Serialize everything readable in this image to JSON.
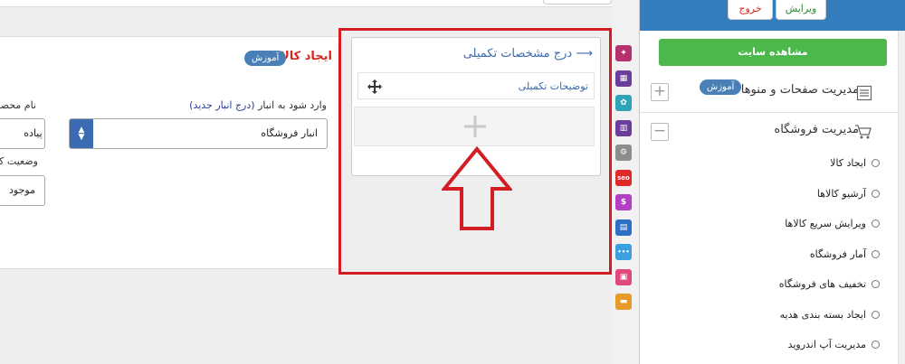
{
  "top_header": {
    "exit_label": "خروج",
    "edit_label": "ویرایش"
  },
  "sidebar": {
    "view_site_label": "مشاهده سایت",
    "pages_menu_label": "مدیریت صفحات و منوها",
    "pages_help_badge": "آموزش",
    "pages_toggle": "+",
    "store_menu_label": "مدیریت فروشگاه",
    "store_toggle": "−",
    "store_items": [
      {
        "label": "ایجاد کالا"
      },
      {
        "label": "آرشیو کالاها"
      },
      {
        "label": "ویرایش سریع کالاها"
      },
      {
        "label": "آمار فروشگاه"
      },
      {
        "label": "تخفیف های فروشگاه"
      },
      {
        "label": "ایجاد بسته بندی هدیه"
      },
      {
        "label": "مدیریت آپ اندروید"
      }
    ]
  },
  "form": {
    "title": "ایجاد کالا",
    "help_badge": "آموزش",
    "warehouse_label": "وارد شود به انبار",
    "warehouse_link": "(درج انبار جدید)",
    "warehouse_value": "انبار فروشگاه",
    "name_label": "نام محصول",
    "name_value": "کفش پیاده",
    "status_label": "وضعیت کالا",
    "status_value": "موجود"
  },
  "spec_panel": {
    "title": "درج مشخصات تکمیلی",
    "arrow": "⟶",
    "row_label": "توضیحات تکمیلی"
  },
  "colors": {
    "header_blue": "#357ebd",
    "view_site_green": "#4cb84c",
    "highlight_red": "#d21d23",
    "link_blue": "#3a6bb3",
    "title_red": "#d9251c"
  },
  "icon_column": [
    {
      "name": "pin-icon",
      "color": "#b5326e",
      "glyph": "✦"
    },
    {
      "name": "grid-icon",
      "color": "#6a3e9a",
      "glyph": "▦"
    },
    {
      "name": "puzzle-icon",
      "color": "#2fa3b8",
      "glyph": "✿"
    },
    {
      "name": "layout-icon",
      "color": "#6a3e9a",
      "glyph": "▥"
    },
    {
      "name": "settings-icon",
      "color": "#8d8d8d",
      "glyph": "⚙"
    },
    {
      "name": "seo-icon",
      "color": "#e02a2a",
      "glyph": "seo"
    },
    {
      "name": "dollar-icon",
      "color": "#b53ec7",
      "glyph": "$"
    },
    {
      "name": "document-icon",
      "color": "#2e70c4",
      "glyph": "▤"
    },
    {
      "name": "chat-icon",
      "color": "#3aa0e0",
      "glyph": "•••"
    },
    {
      "name": "image-icon",
      "color": "#e04a7a",
      "glyph": "▣"
    },
    {
      "name": "folder-icon",
      "color": "#e89a2a",
      "glyph": "▬"
    }
  ]
}
